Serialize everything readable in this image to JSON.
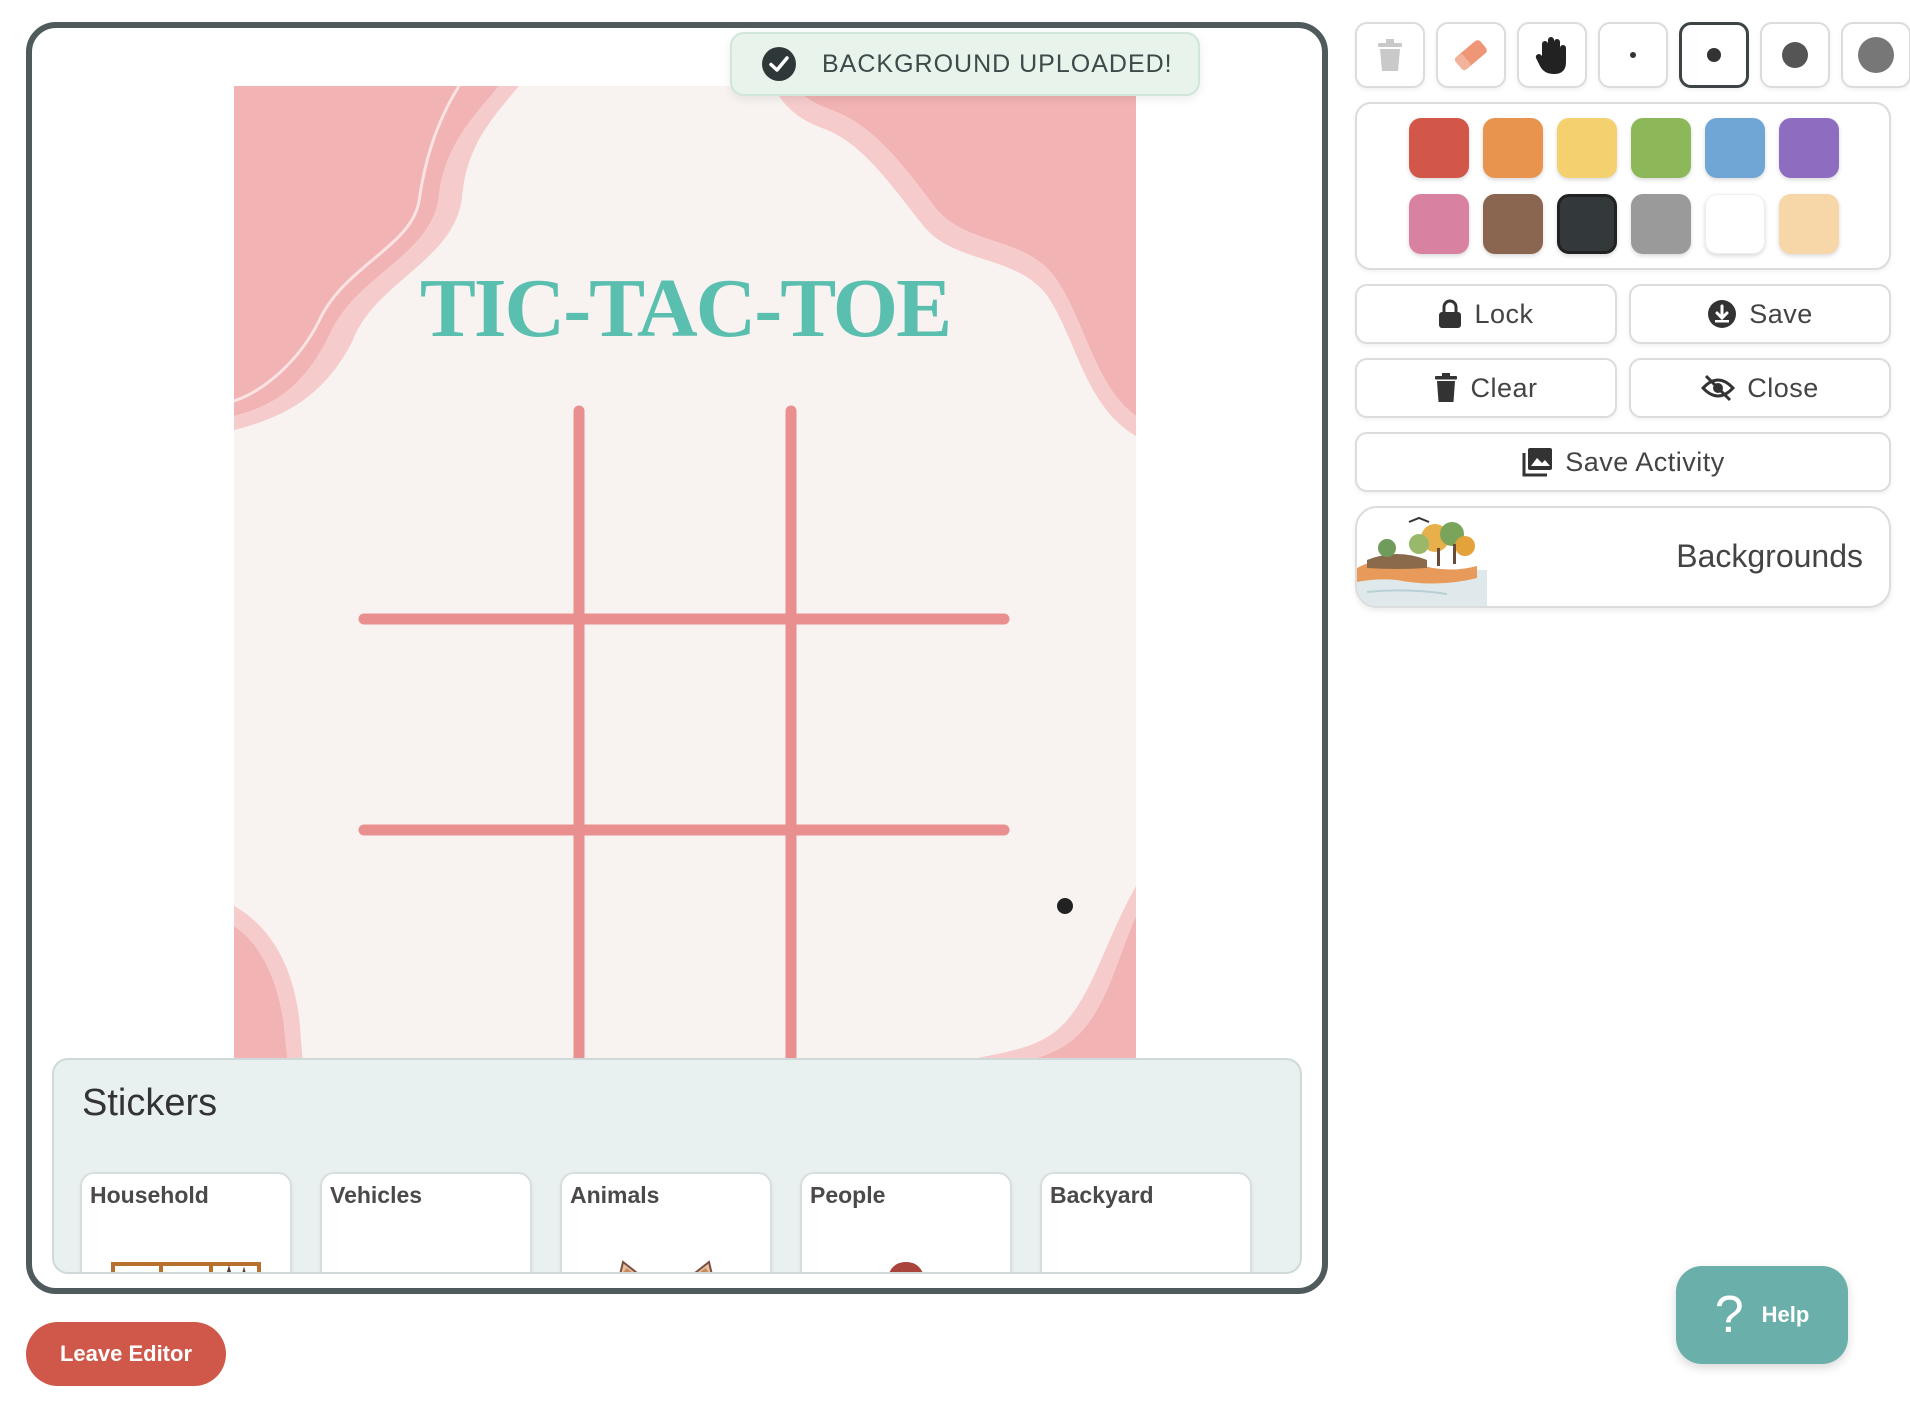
{
  "toast": {
    "message": "BACKGROUND UPLOADED!",
    "icon": "check-circle-icon"
  },
  "canvas": {
    "title": "TIC-TAC-TOE",
    "colors": {
      "background": "#f8f3f1",
      "accent": "#f1b3b3",
      "grid": "#ea8f8f",
      "title": "#5bbfb0"
    }
  },
  "stickers": {
    "title": "Stickers",
    "categories": [
      {
        "label": "Household"
      },
      {
        "label": "Vehicles"
      },
      {
        "label": "Animals"
      },
      {
        "label": "People"
      },
      {
        "label": "Backyard"
      }
    ]
  },
  "tools": [
    {
      "name": "trash-icon",
      "selected": false
    },
    {
      "name": "eraser-icon",
      "selected": false
    },
    {
      "name": "hand-icon",
      "selected": false
    },
    {
      "name": "brush-size-xs",
      "selected": false
    },
    {
      "name": "brush-size-s",
      "selected": true
    },
    {
      "name": "brush-size-m",
      "selected": false
    },
    {
      "name": "brush-size-l",
      "selected": false
    }
  ],
  "palette": [
    {
      "color": "#d2574a",
      "selected": false
    },
    {
      "color": "#e8944e",
      "selected": false
    },
    {
      "color": "#f4d06f",
      "selected": false
    },
    {
      "color": "#8cb85a",
      "selected": false
    },
    {
      "color": "#6fa6d6",
      "selected": false
    },
    {
      "color": "#8e6cc0",
      "selected": false
    },
    {
      "color": "#d981a0",
      "selected": false
    },
    {
      "color": "#8a6650",
      "selected": false
    },
    {
      "color": "#33383a",
      "selected": true
    },
    {
      "color": "#9a9a9a",
      "selected": false
    },
    {
      "color": "#ffffff",
      "selected": false
    },
    {
      "color": "#f7d6a8",
      "selected": false
    }
  ],
  "actions": {
    "lock": "Lock",
    "save": "Save",
    "clear": "Clear",
    "close": "Close",
    "save_activity": "Save Activity"
  },
  "backgrounds": {
    "label": "Backgrounds"
  },
  "leave_editor": "Leave Editor",
  "help": {
    "label": "Help",
    "glyph": "?"
  }
}
